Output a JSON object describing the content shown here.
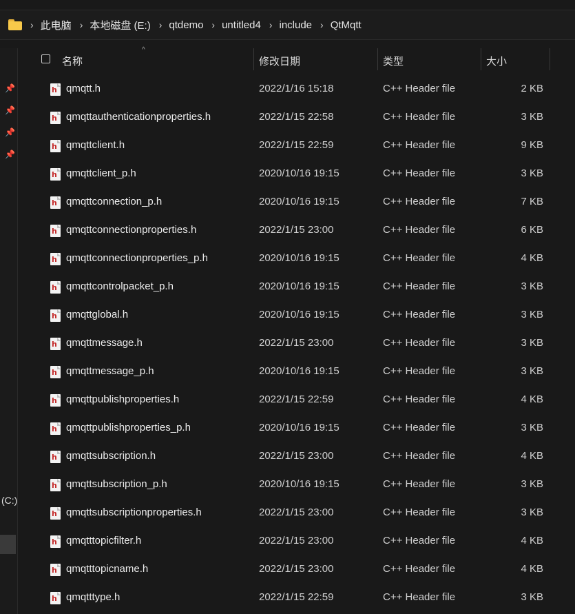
{
  "breadcrumb": [
    "此电脑",
    "本地磁盘 (E:)",
    "qtdemo",
    "untitled4",
    "include",
    "QtMqtt"
  ],
  "breadcrumb_separator": "›",
  "nav": {
    "drive_label": "(C:)"
  },
  "columns": {
    "name": "名称",
    "date": "修改日期",
    "type": "类型",
    "size": "大小"
  },
  "files": [
    {
      "name": "qmqtt.h",
      "date": "2022/1/16 15:18",
      "type": "C++ Header file",
      "size": "2 KB"
    },
    {
      "name": "qmqttauthenticationproperties.h",
      "date": "2022/1/15 22:58",
      "type": "C++ Header file",
      "size": "3 KB"
    },
    {
      "name": "qmqttclient.h",
      "date": "2022/1/15 22:59",
      "type": "C++ Header file",
      "size": "9 KB"
    },
    {
      "name": "qmqttclient_p.h",
      "date": "2020/10/16 19:15",
      "type": "C++ Header file",
      "size": "3 KB"
    },
    {
      "name": "qmqttconnection_p.h",
      "date": "2020/10/16 19:15",
      "type": "C++ Header file",
      "size": "7 KB"
    },
    {
      "name": "qmqttconnectionproperties.h",
      "date": "2022/1/15 23:00",
      "type": "C++ Header file",
      "size": "6 KB"
    },
    {
      "name": "qmqttconnectionproperties_p.h",
      "date": "2020/10/16 19:15",
      "type": "C++ Header file",
      "size": "4 KB"
    },
    {
      "name": "qmqttcontrolpacket_p.h",
      "date": "2020/10/16 19:15",
      "type": "C++ Header file",
      "size": "3 KB"
    },
    {
      "name": "qmqttglobal.h",
      "date": "2020/10/16 19:15",
      "type": "C++ Header file",
      "size": "3 KB"
    },
    {
      "name": "qmqttmessage.h",
      "date": "2022/1/15 23:00",
      "type": "C++ Header file",
      "size": "3 KB"
    },
    {
      "name": "qmqttmessage_p.h",
      "date": "2020/10/16 19:15",
      "type": "C++ Header file",
      "size": "3 KB"
    },
    {
      "name": "qmqttpublishproperties.h",
      "date": "2022/1/15 22:59",
      "type": "C++ Header file",
      "size": "4 KB"
    },
    {
      "name": "qmqttpublishproperties_p.h",
      "date": "2020/10/16 19:15",
      "type": "C++ Header file",
      "size": "3 KB"
    },
    {
      "name": "qmqttsubscription.h",
      "date": "2022/1/15 23:00",
      "type": "C++ Header file",
      "size": "4 KB"
    },
    {
      "name": "qmqttsubscription_p.h",
      "date": "2020/10/16 19:15",
      "type": "C++ Header file",
      "size": "3 KB"
    },
    {
      "name": "qmqttsubscriptionproperties.h",
      "date": "2022/1/15 23:00",
      "type": "C++ Header file",
      "size": "3 KB"
    },
    {
      "name": "qmqtttopicfilter.h",
      "date": "2022/1/15 23:00",
      "type": "C++ Header file",
      "size": "4 KB"
    },
    {
      "name": "qmqtttopicname.h",
      "date": "2022/1/15 23:00",
      "type": "C++ Header file",
      "size": "4 KB"
    },
    {
      "name": "qmqtttype.h",
      "date": "2022/1/15 22:59",
      "type": "C++ Header file",
      "size": "3 KB"
    }
  ]
}
